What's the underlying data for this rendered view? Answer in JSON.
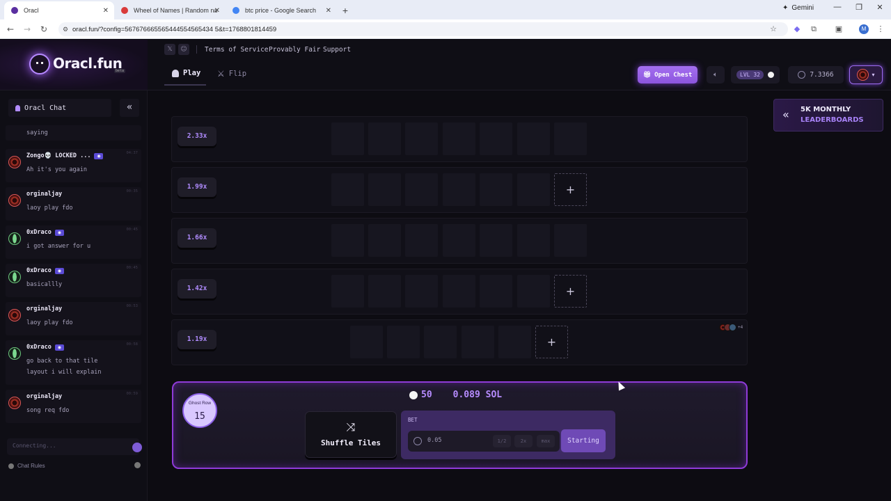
{
  "browser": {
    "tabs": [
      {
        "title": "Oracl",
        "active": true,
        "favicon_color": "#5a2fa0"
      },
      {
        "title": "Wheel of Names | Random nam",
        "active": false,
        "favicon_color": "#d93a3a"
      },
      {
        "title": "btc price - Google Search",
        "active": false,
        "favicon_color": "#4285f4"
      }
    ],
    "gemini_label": "Gemini",
    "url": "oracl.fun/?config=567676665565444554565434 5&t=1768801814459",
    "profile_initial": "M"
  },
  "site": {
    "logo_text": "Oracl.fun",
    "beta_label": "beta",
    "top_links": [
      "Terms of Service",
      "Provably Fair",
      "Support"
    ],
    "modes": [
      {
        "label": "Play",
        "active": true
      },
      {
        "label": "Flip",
        "active": false
      }
    ],
    "open_chest_label": "Open Chest",
    "level_label": "LVL 32",
    "balance": "7.3366",
    "accent_color": "#a56ff0"
  },
  "chat": {
    "title": "Oracl Chat",
    "top_fragment": "saying",
    "messages": [
      {
        "name": "Zongo💀 LOCKED ...",
        "text": "Ah it's you again",
        "avatar": "red",
        "discord": true,
        "time": "04:37"
      },
      {
        "name": "orginaljay",
        "text": "laoy play fdo",
        "avatar": "red",
        "discord": false,
        "time": "00:35"
      },
      {
        "name": "0xDraco",
        "text": "i got answer for u",
        "avatar": "green",
        "discord": true,
        "time": "00:45"
      },
      {
        "name": "0xDraco",
        "text": "basicallly",
        "avatar": "green",
        "discord": true,
        "time": "00:45"
      },
      {
        "name": "orginaljay",
        "text": "laoy play fdo",
        "avatar": "red",
        "discord": false,
        "time": "00:53"
      },
      {
        "name": "0xDraco",
        "text": "go back to that tile layout i will explain",
        "avatar": "green",
        "discord": true,
        "time": "00:58"
      },
      {
        "name": "orginaljay",
        "text": "song req fdo",
        "avatar": "red",
        "discord": false,
        "time": "00:59"
      }
    ],
    "input_placeholder": "Connecting...",
    "rules_label": "Chat Rules"
  },
  "board": {
    "rows": [
      {
        "multiplier": "2.33x",
        "tiles": 7,
        "has_add": false
      },
      {
        "multiplier": "1.99x",
        "tiles": 6,
        "has_add": true
      },
      {
        "multiplier": "1.66x",
        "tiles": 7,
        "has_add": false
      },
      {
        "multiplier": "1.42x",
        "tiles": 6,
        "has_add": true
      },
      {
        "multiplier": "1.19x",
        "tiles": 5,
        "has_add": true
      }
    ],
    "players_more": "+4"
  },
  "leaderboard": {
    "line1": "5K MONTHLY",
    "line2": "LEADERBOARDS"
  },
  "panel": {
    "ghost_row_label": "Ghost Row",
    "ghost_row_value": "15",
    "ghost_count": "50",
    "sol_amount": "0.089 SOL",
    "shuffle_label": "Shuffle Tiles",
    "bet_label": "BET",
    "bet_value": "0.05",
    "bet_half": "1/2",
    "bet_double": "2x",
    "bet_max": "max",
    "start_label": "Starting"
  }
}
